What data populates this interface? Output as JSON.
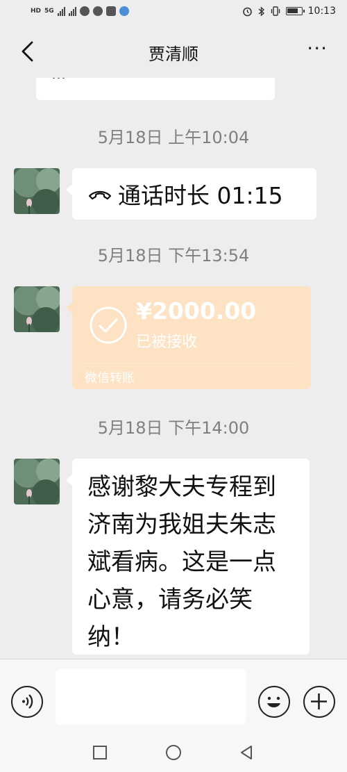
{
  "status_bar": {
    "network_label": "HD",
    "signal_label": "5G",
    "time": "10:13"
  },
  "header": {
    "title": "贾清顺"
  },
  "chat": {
    "clipped_message": "...",
    "messages": [
      {
        "type": "timestamp",
        "text": "5月18日 上午10:04"
      },
      {
        "type": "call",
        "text": "通话时长 01:15"
      },
      {
        "type": "timestamp",
        "text": "5月18日 下午13:54"
      },
      {
        "type": "transfer",
        "amount": "¥2000.00",
        "status": "已被接收",
        "label": "微信转账"
      },
      {
        "type": "timestamp",
        "text": "5月18日 下午14:00"
      },
      {
        "type": "text",
        "text": "感谢黎大夫专程到济南为我姐夫朱志斌看病。这是一点心意，请务必笑纳！"
      }
    ]
  },
  "colors": {
    "background": "#ededed",
    "transfer_bubble": "#fde2c4",
    "timestamp": "#7f7f7f"
  }
}
